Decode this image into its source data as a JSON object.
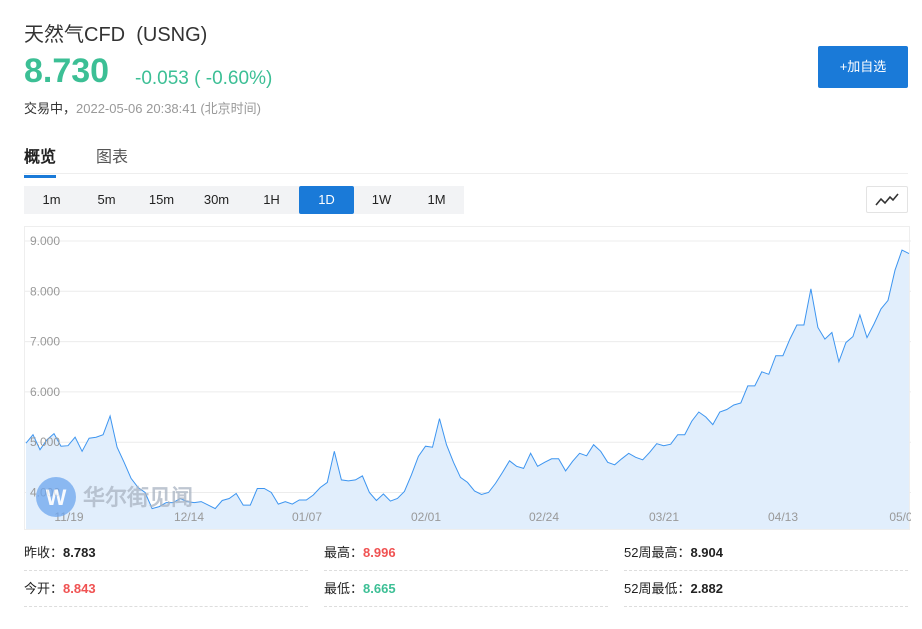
{
  "header": {
    "title": "天然气CFD  (USNG)",
    "price": "8.730",
    "change": "-0.053 ( -0.60%)",
    "status_label": "交易中，",
    "timestamp": "2022-05-06 20:38:41 (北京时间)",
    "add_button": "+加自选"
  },
  "tabs": [
    {
      "label": "概览",
      "active": true
    },
    {
      "label": "图表",
      "active": false
    }
  ],
  "periods": [
    {
      "label": "1m"
    },
    {
      "label": "5m"
    },
    {
      "label": "15m"
    },
    {
      "label": "30m"
    },
    {
      "label": "1H"
    },
    {
      "label": "1D",
      "active": true
    },
    {
      "label": "1W"
    },
    {
      "label": "1M"
    }
  ],
  "colors": {
    "accent": "#1a7ad8",
    "up": "#f05252",
    "down": "#3cbf95",
    "line": "#3d95f0",
    "area": "#e1eefc"
  },
  "watermark": "华尔街见闻",
  "chart_data": {
    "type": "area",
    "ylim": [
      3.6,
      9.25
    ],
    "yticks": [
      "4.000",
      "5.000",
      "6.000",
      "7.000",
      "8.000",
      "9.000"
    ],
    "ytick_values": [
      4,
      5,
      6,
      7,
      8,
      9
    ],
    "xticks": [
      "11/19",
      "12/14",
      "01/07",
      "02/01",
      "02/24",
      "03/21",
      "04/13",
      "05/0"
    ],
    "values": [
      4.98,
      5.15,
      4.85,
      5.05,
      5.17,
      4.92,
      4.93,
      5.1,
      4.82,
      5.08,
      5.1,
      5.15,
      5.52,
      4.9,
      4.6,
      4.28,
      4.1,
      4.0,
      3.68,
      3.72,
      3.8,
      3.8,
      3.88,
      3.82,
      3.8,
      3.82,
      3.75,
      3.68,
      3.84,
      3.88,
      3.98,
      3.75,
      3.75,
      4.08,
      4.08,
      4.0,
      3.77,
      3.82,
      3.77,
      3.85,
      3.85,
      3.95,
      4.1,
      4.2,
      4.82,
      4.25,
      4.23,
      4.25,
      4.33,
      4.0,
      3.84,
      3.97,
      3.83,
      3.88,
      4.02,
      4.35,
      4.72,
      4.92,
      4.9,
      5.47,
      4.95,
      4.6,
      4.3,
      4.2,
      4.03,
      3.96,
      4.0,
      4.18,
      4.4,
      4.63,
      4.52,
      4.48,
      4.78,
      4.52,
      4.6,
      4.67,
      4.67,
      4.43,
      4.62,
      4.78,
      4.73,
      4.95,
      4.82,
      4.6,
      4.55,
      4.67,
      4.78,
      4.7,
      4.65,
      4.8,
      4.97,
      4.93,
      4.96,
      5.15,
      5.15,
      5.42,
      5.6,
      5.5,
      5.35,
      5.6,
      5.65,
      5.74,
      5.78,
      6.12,
      6.12,
      6.4,
      6.35,
      6.72,
      6.72,
      7.05,
      7.33,
      7.33,
      8.05,
      7.28,
      7.05,
      7.18,
      6.6,
      6.98,
      7.1,
      7.53,
      7.08,
      7.35,
      7.65,
      7.82,
      8.42,
      8.82,
      8.75
    ]
  },
  "stats": [
    {
      "label": "昨收：",
      "value": "8.783",
      "tone": "neutral"
    },
    {
      "label": "最高：",
      "value": "8.996",
      "tone": "up"
    },
    {
      "label": "52周最高：",
      "value": "8.904",
      "tone": "neutral"
    },
    {
      "label": "今开：",
      "value": "8.843",
      "tone": "up"
    },
    {
      "label": "最低：",
      "value": "8.665",
      "tone": "down"
    },
    {
      "label": "52周最低：",
      "value": "2.882",
      "tone": "neutral"
    }
  ]
}
